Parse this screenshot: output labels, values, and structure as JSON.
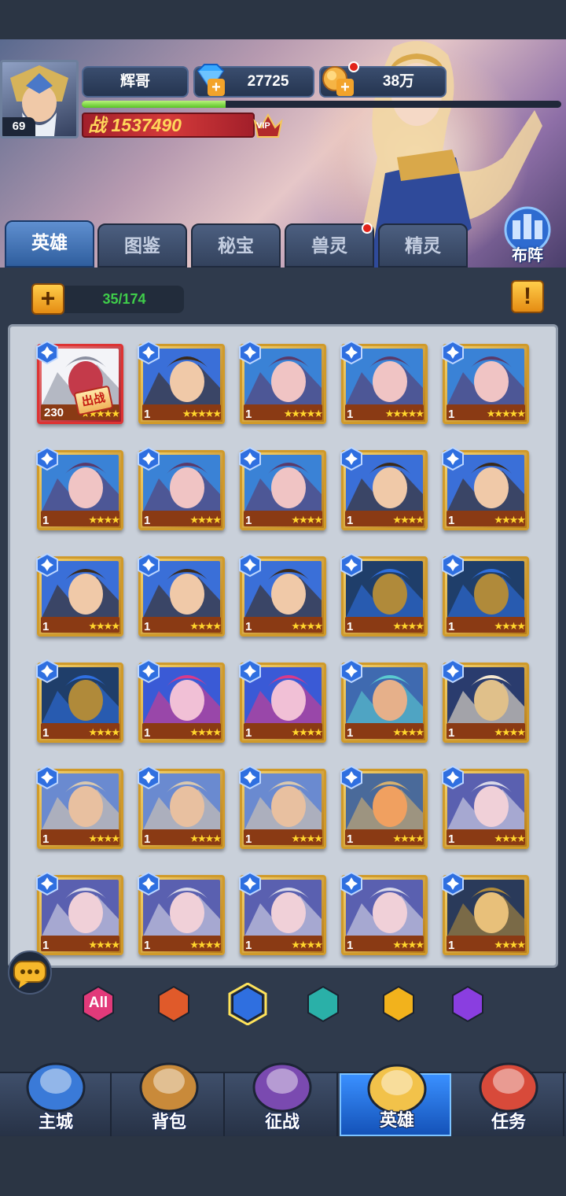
{
  "player": {
    "name": "辉哥",
    "level": "69",
    "power_char": "战",
    "power": "1537490",
    "vip": "VIP",
    "xp_fraction": 0.3
  },
  "currency": {
    "diamonds": "27725",
    "gold": "38万"
  },
  "formation_label": "布阵",
  "tabs": [
    {
      "label": "英雄",
      "active": true
    },
    {
      "label": "图鉴"
    },
    {
      "label": "秘宝"
    },
    {
      "label": "兽灵",
      "dot": true
    },
    {
      "label": "精灵"
    }
  ],
  "hero_count": "35/174",
  "info_symbol": "!",
  "add_symbol": "+",
  "deployed_label": "出战",
  "heroes": [
    {
      "level": "230",
      "kind": "silver",
      "stars": 5,
      "deployed": true
    },
    {
      "level": "1",
      "kind": "dark",
      "stars": 5
    },
    {
      "level": "1",
      "kind": "goggle",
      "stars": 5
    },
    {
      "level": "1",
      "kind": "goggle",
      "stars": 5
    },
    {
      "level": "1",
      "kind": "goggle",
      "stars": 5
    },
    {
      "level": "1",
      "kind": "goggle",
      "stars": 4
    },
    {
      "level": "1",
      "kind": "goggle",
      "stars": 4
    },
    {
      "level": "1",
      "kind": "goggle",
      "stars": 4
    },
    {
      "level": "1",
      "kind": "dark",
      "stars": 4
    },
    {
      "level": "1",
      "kind": "dark",
      "stars": 4
    },
    {
      "level": "1",
      "kind": "dark",
      "stars": 4
    },
    {
      "level": "1",
      "kind": "dark",
      "stars": 4
    },
    {
      "level": "1",
      "kind": "dark",
      "stars": 4
    },
    {
      "level": "1",
      "kind": "knight",
      "stars": 4
    },
    {
      "level": "1",
      "kind": "knight",
      "stars": 4
    },
    {
      "level": "1",
      "kind": "knight",
      "stars": 4
    },
    {
      "level": "1",
      "kind": "pink",
      "stars": 4
    },
    {
      "level": "1",
      "kind": "pink",
      "stars": 4
    },
    {
      "level": "1",
      "kind": "dwarf",
      "stars": 4
    },
    {
      "level": "1",
      "kind": "mask",
      "stars": 4
    },
    {
      "level": "1",
      "kind": "elder",
      "stars": 4
    },
    {
      "level": "1",
      "kind": "elder",
      "stars": 4
    },
    {
      "level": "1",
      "kind": "elder",
      "stars": 4
    },
    {
      "level": "1",
      "kind": "pirate",
      "stars": 4
    },
    {
      "level": "1",
      "kind": "mage",
      "stars": 4
    },
    {
      "level": "1",
      "kind": "mage",
      "stars": 4
    },
    {
      "level": "1",
      "kind": "mage",
      "stars": 4
    },
    {
      "level": "1",
      "kind": "mage",
      "stars": 4
    },
    {
      "level": "1",
      "kind": "mage",
      "stars": 4
    },
    {
      "level": "1",
      "kind": "golden",
      "stars": 4
    }
  ],
  "filters": [
    {
      "name": "filter-all",
      "label": "All",
      "color": "#e23a7a"
    },
    {
      "name": "filter-fire",
      "color": "#e05a2a"
    },
    {
      "name": "filter-water",
      "color": "#2f6fe0",
      "active": true
    },
    {
      "name": "filter-skull",
      "color": "#2ab0a8"
    },
    {
      "name": "filter-wind",
      "color": "#f2b21c"
    },
    {
      "name": "filter-shadow",
      "color": "#8a3ee0"
    }
  ],
  "nav": [
    {
      "name": "main-city",
      "label": "主城",
      "icon": "castle-icon"
    },
    {
      "name": "backpack",
      "label": "背包",
      "icon": "chest-icon"
    },
    {
      "name": "battle",
      "label": "征战",
      "icon": "dragon-orb-icon"
    },
    {
      "name": "heroes",
      "label": "英雄",
      "icon": "helmet-icon",
      "active": true
    },
    {
      "name": "quests",
      "label": "任务",
      "icon": "scroll-icon"
    }
  ]
}
